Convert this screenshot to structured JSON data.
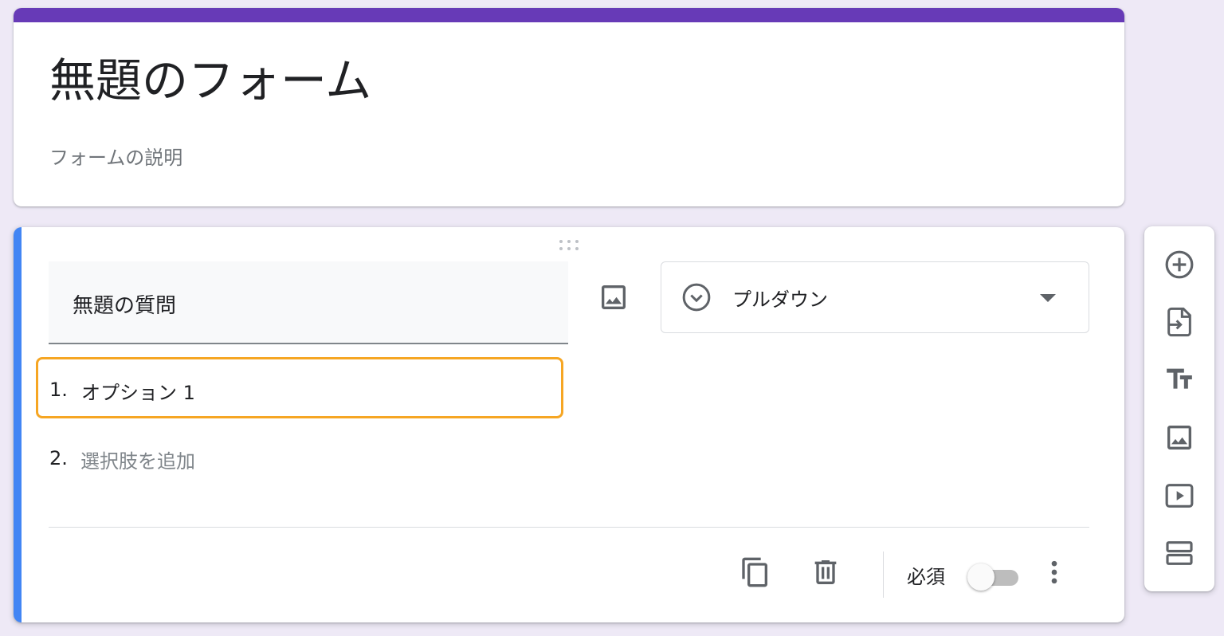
{
  "form": {
    "title": "無題のフォーム",
    "description": "フォームの説明",
    "theme_color": "#673ab7"
  },
  "question": {
    "title": "無題の質問",
    "accent_color": "#4285f4",
    "type_select": {
      "selected": "プルダウン",
      "icon": "dropdown-circle-icon"
    },
    "options": [
      {
        "number": "1.",
        "text": "オプション 1"
      }
    ],
    "add_option": {
      "number": "2.",
      "text": "選択肢を追加"
    },
    "footer": {
      "required_label": "必須",
      "required": false,
      "icons": [
        "copy-icon",
        "delete-icon",
        "more-vert-icon"
      ]
    }
  },
  "toolbar": {
    "icons": [
      "add-question-icon",
      "import-questions-icon",
      "title-text-icon",
      "image-icon",
      "video-icon",
      "section-icon"
    ]
  },
  "colors": {
    "focus_outline": "#f6a623",
    "background": "#eee9f6"
  }
}
